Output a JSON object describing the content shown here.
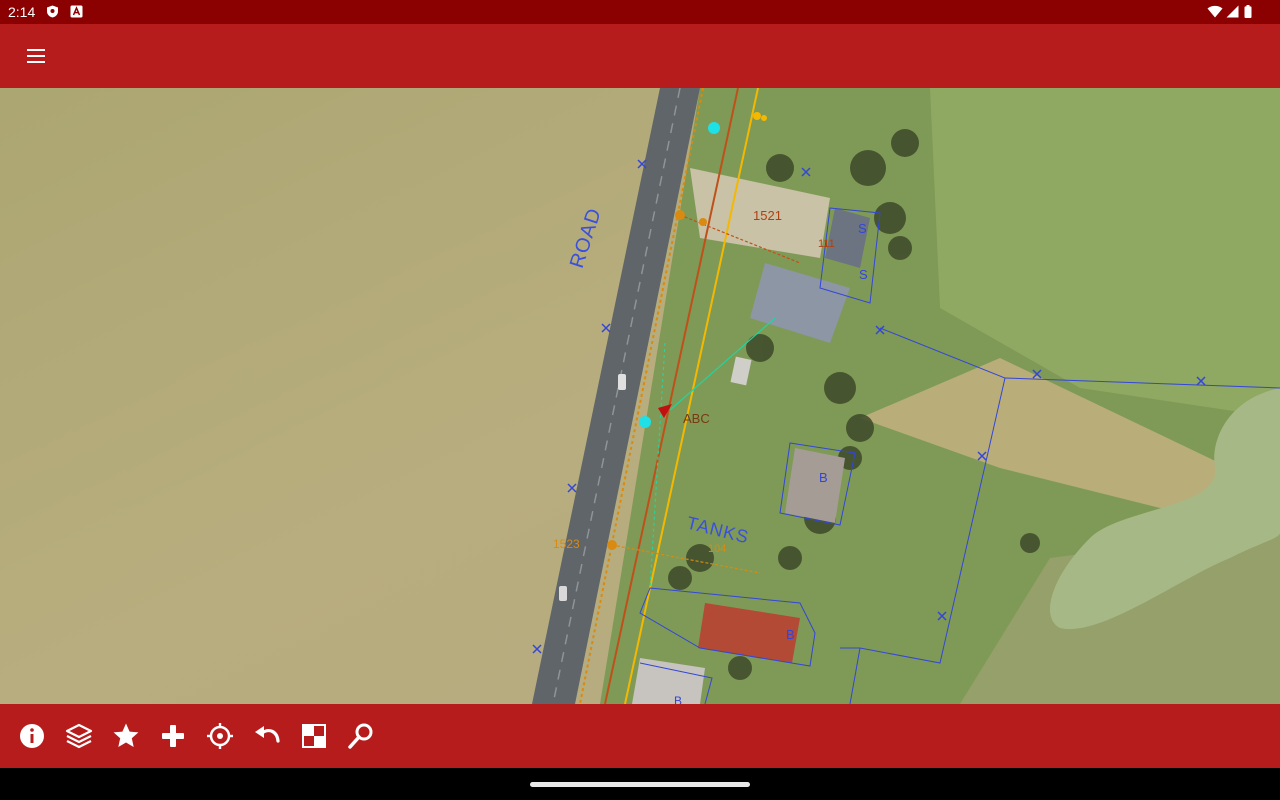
{
  "status_bar": {
    "time": "2:14",
    "left_icons": [
      "shield-icon",
      "a-box-icon"
    ],
    "right_icons": [
      "wifi-icon",
      "cell-signal-icon",
      "battery-icon"
    ]
  },
  "app_bar": {
    "menu_icon": "menu-icon"
  },
  "colors": {
    "status_bar": "#8b0000",
    "app_bar": "#b71c1c",
    "road_label": "#3a4fe0",
    "parcel_lines": "#3346d8",
    "pipe_orange": "#d98a10",
    "pipe_yellow": "#f5b800",
    "pipe_dark_orange": "#c0501a",
    "cyan_points": "#1ee0e6"
  },
  "map": {
    "labels": {
      "road": "ROAD",
      "tanks": "TANKS",
      "abc": "ABC",
      "n1521": "1521",
      "n1523": "1523",
      "n111": "111",
      "n104": "104",
      "s1": "S",
      "s2": "S",
      "b1": "B",
      "b2": "B",
      "b3": "B"
    }
  },
  "toolbar": {
    "items": [
      {
        "icon": "info-icon"
      },
      {
        "icon": "layers-icon"
      },
      {
        "icon": "star-icon"
      },
      {
        "icon": "plus-icon"
      },
      {
        "icon": "gps-locate-icon"
      },
      {
        "icon": "undo-icon"
      },
      {
        "icon": "grid-select-icon"
      },
      {
        "icon": "search-icon"
      }
    ]
  }
}
